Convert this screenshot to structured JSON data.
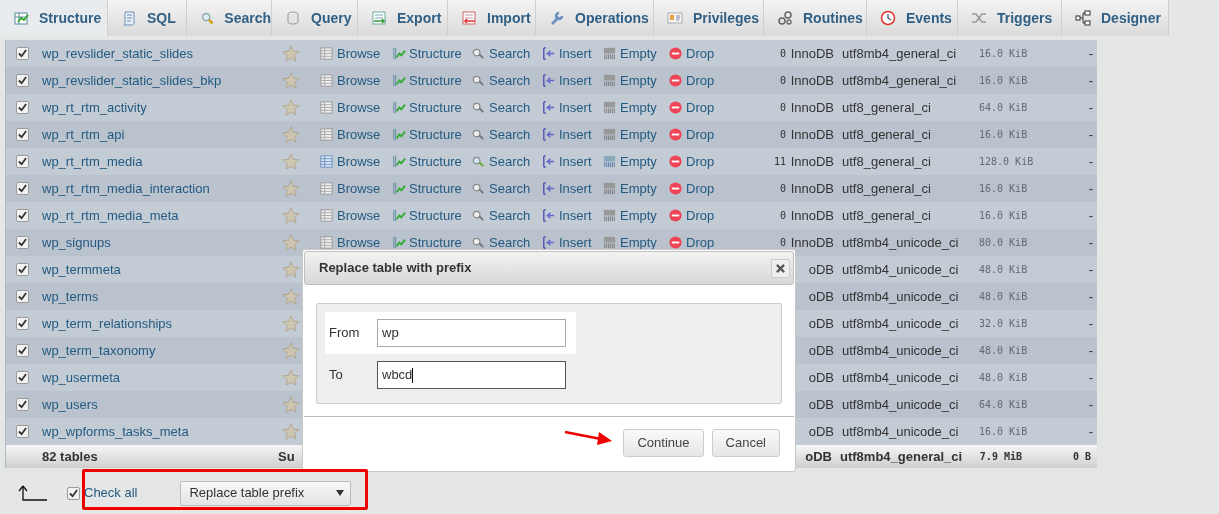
{
  "tabs": [
    {
      "label": "Structure",
      "selected": true
    },
    {
      "label": "SQL",
      "selected": false
    },
    {
      "label": "Search",
      "selected": false
    },
    {
      "label": "Query",
      "selected": false
    },
    {
      "label": "Export",
      "selected": false
    },
    {
      "label": "Import",
      "selected": false
    },
    {
      "label": "Operations",
      "selected": false
    },
    {
      "label": "Privileges",
      "selected": false
    },
    {
      "label": "Routines",
      "selected": false
    },
    {
      "label": "Events",
      "selected": false
    },
    {
      "label": "Triggers",
      "selected": false
    },
    {
      "label": "Designer",
      "selected": false
    }
  ],
  "table": {
    "rows": [
      {
        "checked": true,
        "name": "wp_revslider_static_slides",
        "has_data": false,
        "actions": [
          "Browse",
          "Structure",
          "Search",
          "Insert",
          "Empty",
          "Drop"
        ],
        "rows": "0",
        "engine": "InnoDB",
        "collation": "utf8mb4_general_ci",
        "size": "16.0 KiB",
        "overhead": "-"
      },
      {
        "checked": true,
        "name": "wp_revslider_static_slides_bkp",
        "has_data": false,
        "actions": [
          "Browse",
          "Structure",
          "Search",
          "Insert",
          "Empty",
          "Drop"
        ],
        "rows": "0",
        "engine": "InnoDB",
        "collation": "utf8mb4_general_ci",
        "size": "16.0 KiB",
        "overhead": "-"
      },
      {
        "checked": true,
        "name": "wp_rt_rtm_activity",
        "has_data": false,
        "actions": [
          "Browse",
          "Structure",
          "Search",
          "Insert",
          "Empty",
          "Drop"
        ],
        "rows": "0",
        "engine": "InnoDB",
        "collation": "utf8_general_ci",
        "size": "64.0 KiB",
        "overhead": "-"
      },
      {
        "checked": true,
        "name": "wp_rt_rtm_api",
        "has_data": false,
        "actions": [
          "Browse",
          "Structure",
          "Search",
          "Insert",
          "Empty",
          "Drop"
        ],
        "rows": "0",
        "engine": "InnoDB",
        "collation": "utf8_general_ci",
        "size": "16.0 KiB",
        "overhead": "-"
      },
      {
        "checked": true,
        "name": "wp_rt_rtm_media",
        "has_data": true,
        "actions": [
          "Browse",
          "Structure",
          "Search",
          "Insert",
          "Empty",
          "Drop"
        ],
        "rows": "11",
        "engine": "InnoDB",
        "collation": "utf8_general_ci",
        "size": "128.0 KiB",
        "overhead": "-"
      },
      {
        "checked": true,
        "name": "wp_rt_rtm_media_interaction",
        "has_data": false,
        "actions": [
          "Browse",
          "Structure",
          "Search",
          "Insert",
          "Empty",
          "Drop"
        ],
        "rows": "0",
        "engine": "InnoDB",
        "collation": "utf8_general_ci",
        "size": "16.0 KiB",
        "overhead": "-"
      },
      {
        "checked": true,
        "name": "wp_rt_rtm_media_meta",
        "has_data": false,
        "actions": [
          "Browse",
          "Structure",
          "Search",
          "Insert",
          "Empty",
          "Drop"
        ],
        "rows": "0",
        "engine": "InnoDB",
        "collation": "utf8_general_ci",
        "size": "16.0 KiB",
        "overhead": "-"
      },
      {
        "checked": true,
        "name": "wp_signups",
        "has_data": false,
        "actions": [
          "Browse",
          "Structure",
          "Search",
          "Insert",
          "Empty",
          "Drop"
        ],
        "rows": "0",
        "engine": "InnoDB",
        "collation": "utf8mb4_unicode_ci",
        "size": "80.0 KiB",
        "overhead": "-"
      },
      {
        "checked": true,
        "name": "wp_termmeta",
        "engine": "oDB",
        "collation": "utf8mb4_unicode_ci",
        "size": "48.0 KiB",
        "overhead": "-"
      },
      {
        "checked": true,
        "name": "wp_terms",
        "engine": "oDB",
        "collation": "utf8mb4_unicode_ci",
        "size": "48.0 KiB",
        "overhead": "-"
      },
      {
        "checked": true,
        "name": "wp_term_relationships",
        "engine": "oDB",
        "collation": "utf8mb4_unicode_ci",
        "size": "32.0 KiB",
        "overhead": "-"
      },
      {
        "checked": true,
        "name": "wp_term_taxonomy",
        "engine": "oDB",
        "collation": "utf8mb4_unicode_ci",
        "size": "48.0 KiB",
        "overhead": "-"
      },
      {
        "checked": true,
        "name": "wp_usermeta",
        "engine": "oDB",
        "collation": "utf8mb4_unicode_ci",
        "size": "48.0 KiB",
        "overhead": "-"
      },
      {
        "checked": true,
        "name": "wp_users",
        "engine": "oDB",
        "collation": "utf8mb4_unicode_ci",
        "size": "64.0 KiB",
        "overhead": "-"
      },
      {
        "checked": true,
        "name": "wp_wpforms_tasks_meta",
        "engine": "oDB",
        "collation": "utf8mb4_unicode_ci",
        "size": "16.0 KiB",
        "overhead": "-"
      }
    ],
    "footer": {
      "label": "82 tables",
      "sum": "Su",
      "engine": "oDB",
      "collation": "utf8mb4_general_ci",
      "size": "7.9 MiB",
      "overhead": "0 B"
    }
  },
  "bulk": {
    "check_all": {
      "label": "Check all",
      "checked": true
    },
    "action": "Replace table prefix"
  },
  "dialog": {
    "title": "Replace table with prefix",
    "fields": [
      {
        "label": "From",
        "value": "wp",
        "focused": false
      },
      {
        "label": "To",
        "value": "wbcd",
        "focused": true
      }
    ],
    "buttons": [
      "Continue",
      "Cancel"
    ]
  }
}
